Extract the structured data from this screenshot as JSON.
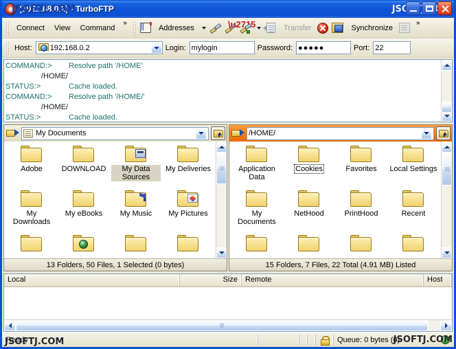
{
  "window": {
    "title": "(192.168.0.2) - TurboFTP",
    "watermark": "JSOFTJ.COM",
    "minimize_label": "Minimize",
    "maximize_label": "Maximize",
    "close_label": "Close"
  },
  "toolbar": {
    "menus": [
      "Connect",
      "View",
      "Command"
    ],
    "overflow": "»",
    "addresses_label": "Addresses",
    "transfer_label": "Transfer",
    "synchronize_label": "Synchronize",
    "more": "»",
    "icons": {
      "addresses": "address-book-icon",
      "quick_connect": "plug-connect-icon",
      "disconnect": "plug-disconnect-icon",
      "connect_options": "plug-options-icon",
      "transfer": "transfer-icon",
      "stop": "stop-icon",
      "synchronize": "synchronize-icon",
      "report": "report-icon"
    }
  },
  "connection": {
    "host_label": "Host:",
    "host_value": "192.168.0.2",
    "login_label": "Login:",
    "login_value": "mylogin",
    "password_label": "Password:",
    "password_value": "●●●●●",
    "port_label": "Port:",
    "port_value": "22"
  },
  "log": {
    "lines": [
      {
        "tag": "COMMAND:>",
        "msg": "Resolve path '/HOME'"
      },
      {
        "cont": "/HOME/"
      },
      {
        "tag": "STATUS:>",
        "msg": "Cache loaded."
      },
      {
        "tag": "COMMAND:>",
        "msg": "Resolve path '/HOME/'"
      },
      {
        "cont": "/HOME/"
      },
      {
        "tag": "STATUS:>",
        "msg": "Cache loaded."
      }
    ]
  },
  "local_pane": {
    "path": "My Documents",
    "path_icon": "folder-small-icon",
    "pane_icon": "local-folder-icon",
    "up_button": "up-one-level-button",
    "items": [
      {
        "name": "Adobe",
        "overlay": "none"
      },
      {
        "name": "DOWNLOAD",
        "overlay": "none"
      },
      {
        "name": "My Data Sources",
        "overlay": "data",
        "selected": true
      },
      {
        "name": "My Deliveries",
        "overlay": "none"
      },
      {
        "name": "My Downloads",
        "overlay": "none"
      },
      {
        "name": "My eBooks",
        "overlay": "none"
      },
      {
        "name": "My Music",
        "overlay": "music"
      },
      {
        "name": "My Pictures",
        "overlay": "pic"
      },
      {
        "name": "",
        "overlay": "none"
      },
      {
        "name": "",
        "overlay": "globe"
      },
      {
        "name": "",
        "overlay": "none"
      },
      {
        "name": "",
        "overlay": "none"
      }
    ],
    "status": "13 Folders, 50 Files, 1 Selected (0 bytes)"
  },
  "remote_pane": {
    "path": "/HOME/",
    "pane_icon": "remote-folder-icon",
    "up_button": "up-one-level-button",
    "items": [
      {
        "name": "Application Data",
        "overlay": "none"
      },
      {
        "name": "Cookies",
        "overlay": "none",
        "focused": true
      },
      {
        "name": "Favorites",
        "overlay": "none"
      },
      {
        "name": "Local Settings",
        "overlay": "none"
      },
      {
        "name": "My Documents",
        "overlay": "none"
      },
      {
        "name": "NetHood",
        "overlay": "none"
      },
      {
        "name": "PrintHood",
        "overlay": "none"
      },
      {
        "name": "Recent",
        "overlay": "none"
      },
      {
        "name": "",
        "overlay": "none"
      },
      {
        "name": "",
        "overlay": "none"
      },
      {
        "name": "",
        "overlay": "none"
      },
      {
        "name": "",
        "overlay": "none"
      }
    ],
    "status": "15 Folders, 7 Files, 22 Total (4.91 MB) Listed"
  },
  "queue": {
    "columns": [
      "Local",
      "Size",
      "Remote",
      "Host"
    ],
    "rows": []
  },
  "statusbar": {
    "ready": "Ready",
    "watermark_left": "JSOFTJ.COM",
    "watermark_right": "JSOFTJ.COM",
    "queue_text": "Queue: 0 bytes (0)",
    "lock_icon": "secure-lock-icon",
    "led_icon": "connection-led-icon"
  },
  "colors": {
    "title_blue": "#0a50d4",
    "active_pane_orange": "#f97c10",
    "log_teal": "#1d6f6a",
    "folder_yellow": "#f0d370"
  }
}
